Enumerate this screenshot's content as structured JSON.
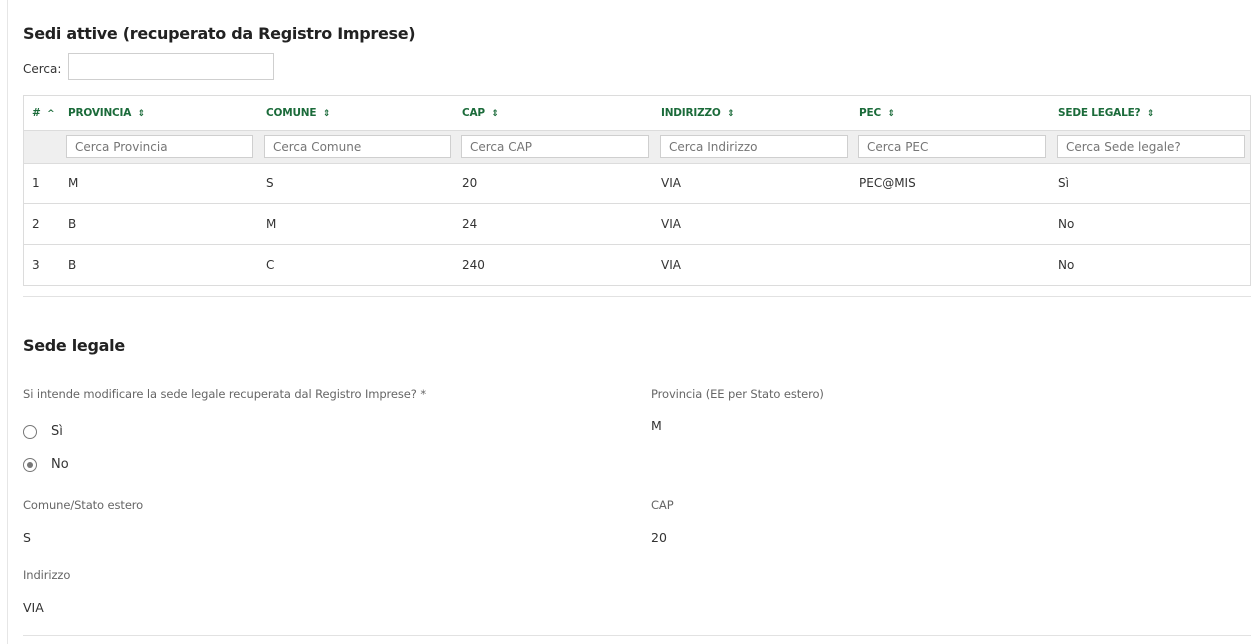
{
  "sedi": {
    "title": "Sedi attive (recuperato da Registro Imprese)",
    "search_label": "Cerca:",
    "search_value": "",
    "columns": {
      "num": "#",
      "provincia": "PROVINCIA",
      "comune": "COMUNE",
      "cap": "CAP",
      "indirizzo": "INDIRIZZO",
      "pec": "PEC",
      "sede_legale": "SEDE LEGALE?"
    },
    "sort_icons": {
      "num": "^",
      "other": "⇕"
    },
    "filters": {
      "provincia": "Cerca Provincia",
      "comune": "Cerca Comune",
      "cap": "Cerca CAP",
      "indirizzo": "Cerca Indirizzo",
      "pec": "Cerca PEC",
      "sede_legale": "Cerca Sede legale?"
    },
    "rows": [
      {
        "num": "1",
        "provincia": "M",
        "comune": "S",
        "cap": "20",
        "indirizzo": "VIA",
        "pec": "PEC@MIS",
        "sede_legale": "Sì"
      },
      {
        "num": "2",
        "provincia": "B",
        "comune": "M",
        "cap": "24",
        "indirizzo": "VIA",
        "pec": "",
        "sede_legale": "No"
      },
      {
        "num": "3",
        "provincia": "B",
        "comune": "C",
        "cap": "240",
        "indirizzo": "VIA",
        "pec": "",
        "sede_legale": "No"
      }
    ]
  },
  "sede_legale": {
    "title": "Sede legale",
    "question_label": "Si intende modificare la sede legale recuperata dal Registro Imprese? *",
    "option_yes": "Sì",
    "option_no": "No",
    "selected": "No",
    "provincia_label": "Provincia (EE per Stato estero)",
    "provincia_value": "M",
    "comune_label": "Comune/Stato estero",
    "comune_value": "S",
    "cap_label": "CAP",
    "cap_value": "20",
    "indirizzo_label": "Indirizzo",
    "indirizzo_value": "VIA"
  }
}
